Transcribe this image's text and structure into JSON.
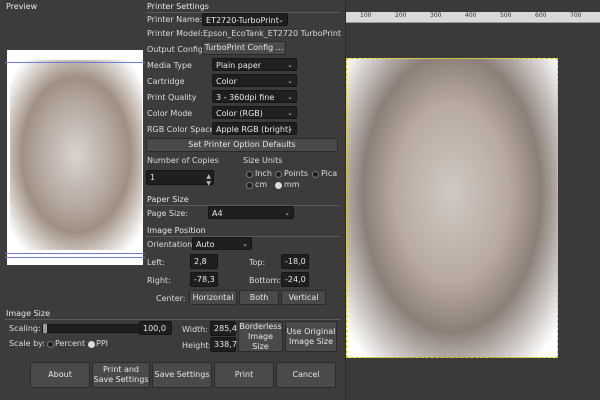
{
  "preview": {
    "title": "Preview"
  },
  "printer_settings": {
    "title": "Printer Settings",
    "printer_name_label": "Printer Name:",
    "printer_name_value": "ET2720-TurboPrint",
    "printer_model_label": "Printer Model:",
    "printer_model_value": "Epson_EcoTank_ET2720 TurboPrint",
    "output_config_label": "Output Config:",
    "output_config_button": "TurboPrint Config ...",
    "media_type_label": "Media Type",
    "media_type_value": "Plain paper",
    "cartridge_label": "Cartridge",
    "cartridge_value": "Color",
    "print_quality_label": "Print Quality",
    "print_quality_value": "3 - 360dpi fine",
    "color_mode_label": "Color Mode",
    "color_mode_value": "Color (RGB)",
    "rgb_color_space_label": "RGB Color Space",
    "rgb_color_space_value": "Apple RGB (bright)",
    "set_defaults_button": "Set Printer Option Defaults"
  },
  "copies": {
    "label": "Number of Copies",
    "value": "1"
  },
  "size_units": {
    "label": "Size Units",
    "options": [
      "Inch",
      "Points",
      "Pica",
      "cm",
      "mm"
    ],
    "selected": "mm"
  },
  "paper_size": {
    "title": "Paper Size",
    "page_size_label": "Page Size:",
    "page_size_value": "A4"
  },
  "image_position": {
    "title": "Image Position",
    "orientation_label": "Orientation:",
    "orientation_value": "Auto",
    "left_label": "Left:",
    "left_value": "2,8",
    "top_label": "Top:",
    "top_value": "-18,0",
    "right_label": "Right:",
    "right_value": "-78,3",
    "bottom_label": "Bottom:",
    "bottom_value": "-24,0",
    "center_label": "Center:",
    "center_buttons": [
      "Horizontal",
      "Both",
      "Vertical"
    ]
  },
  "image_size": {
    "title": "Image Size",
    "scaling_label": "Scaling:",
    "scaling_value": "100,0",
    "scale_by_label": "Scale by:",
    "scale_by_options": [
      "Percent",
      "PPI"
    ],
    "scale_by_selected": "PPI",
    "width_label": "Width:",
    "width_value": "285,4",
    "height_label": "Height:",
    "height_value": "338,7",
    "borderless_button": "Borderless Image Size",
    "use_original_button": "Use Original Image Size"
  },
  "footer_buttons": [
    "About",
    "Print and Save Settings",
    "Save Settings",
    "Print",
    "Cancel"
  ],
  "ruler": {
    "labels": [
      "100",
      "200",
      "300",
      "400",
      "500",
      "600",
      "700"
    ]
  }
}
